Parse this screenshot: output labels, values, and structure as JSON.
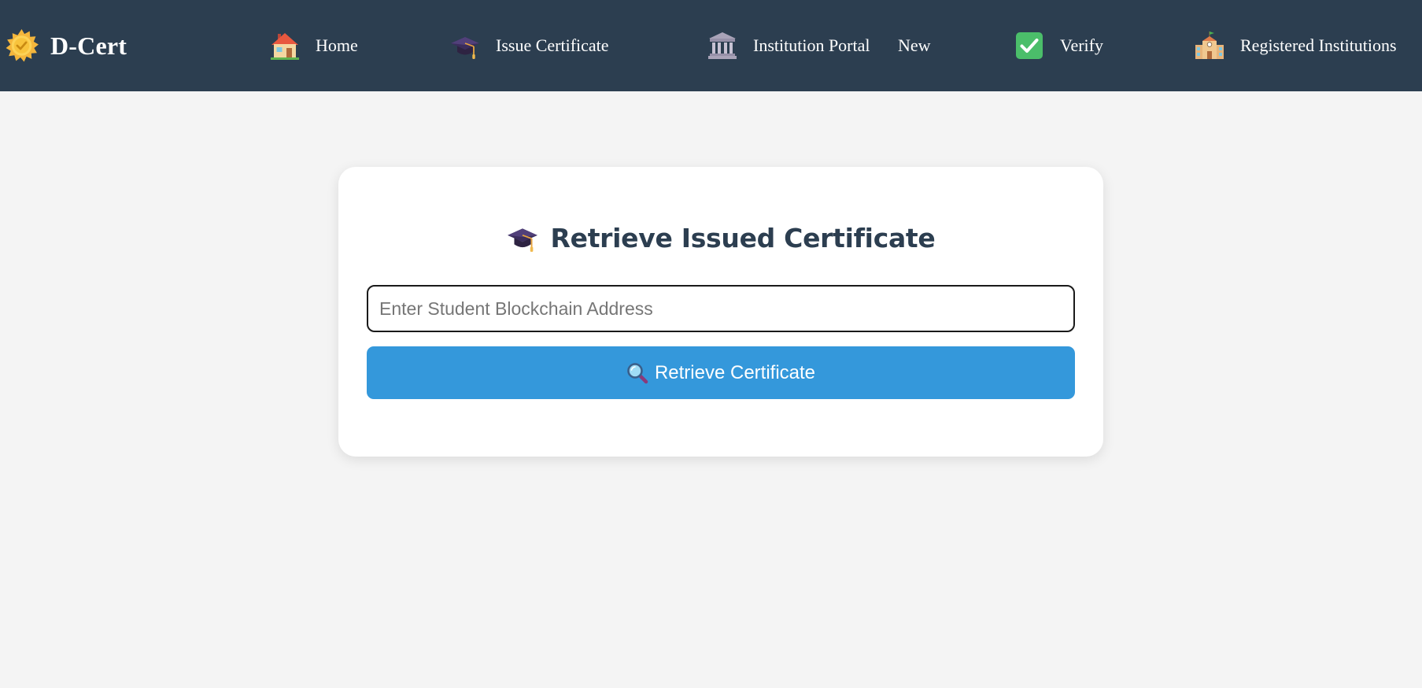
{
  "brand": {
    "name": "D-Cert",
    "icon": "sun-badge-icon"
  },
  "nav": {
    "items": [
      {
        "label": "Home",
        "icon": "house-icon"
      },
      {
        "label": "Issue Certificate",
        "icon": "graduation-cap-icon"
      },
      {
        "label": "Institution Portal",
        "icon": "classical-building-icon"
      },
      {
        "label": "Verify",
        "icon": "check-mark-button-icon"
      },
      {
        "label": "Registered Institutions",
        "icon": "school-icon"
      }
    ],
    "new_label": "New"
  },
  "card": {
    "title": "Retrieve Issued Certificate",
    "title_icon": "graduation-cap-icon",
    "input": {
      "placeholder": "Enter Student Blockchain Address",
      "value": ""
    },
    "button": {
      "label": "Retrieve Certificate",
      "icon": "magnifying-glass-icon"
    }
  },
  "colors": {
    "navbar_bg": "#2c3e50",
    "page_bg": "#f4f4f4",
    "accent": "#3498db",
    "title_text": "#2c3e50"
  }
}
